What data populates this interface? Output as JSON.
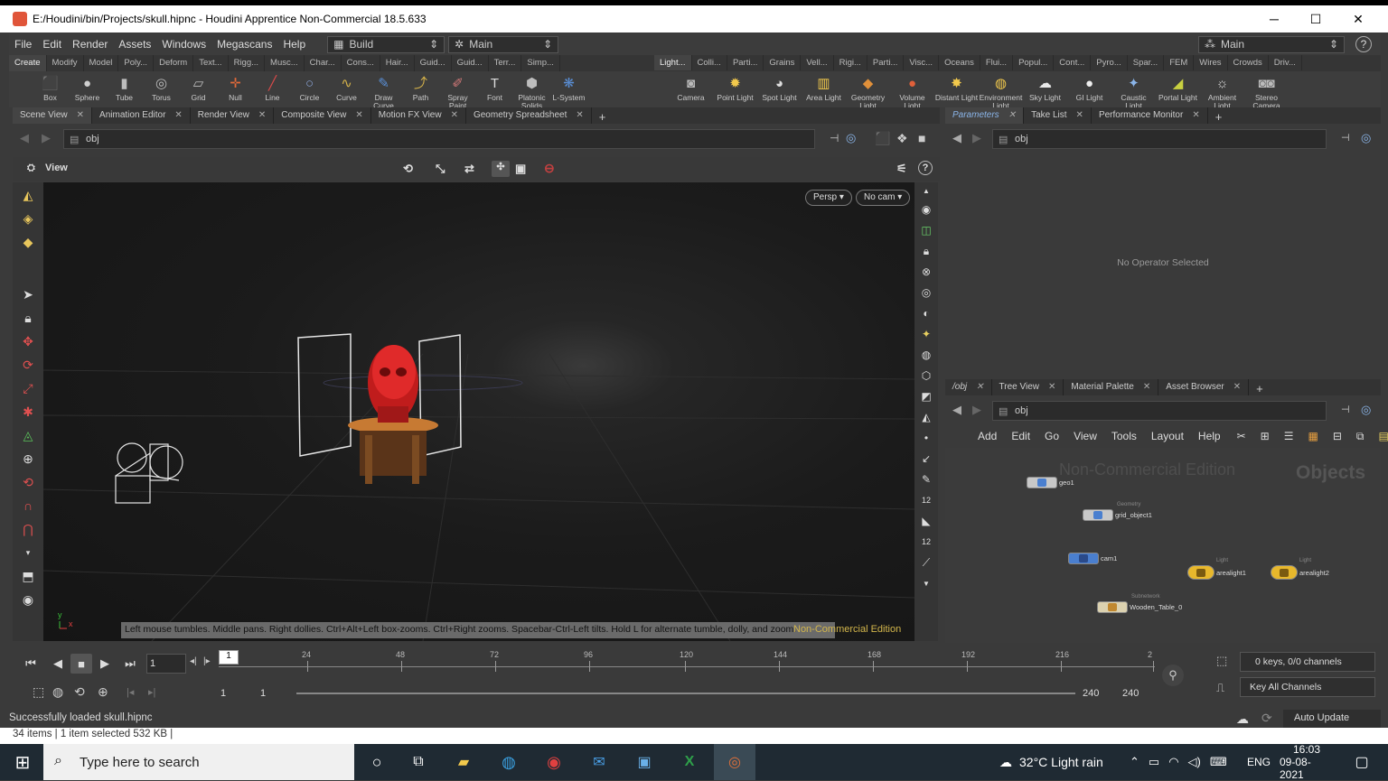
{
  "window": {
    "title": "E:/Houdini/bin/Projects/skull.hipnc - Houdini Apprentice Non-Commercial 18.5.633",
    "minimize": "─",
    "maximize": "☐",
    "close": "✕"
  },
  "menu": {
    "items": [
      "File",
      "Edit",
      "Render",
      "Assets",
      "Windows",
      "Megascans",
      "Help"
    ],
    "desktop": "Build",
    "desktop_right": "Main",
    "view_main": "Main"
  },
  "shelf_tabs_left": [
    "Create",
    "Modify",
    "Model",
    "Poly...",
    "Deform",
    "Text...",
    "Rigg...",
    "Musc...",
    "Char...",
    "Cons...",
    "Hair...",
    "Guid...",
    "Guid...",
    "Terr...",
    "Simp..."
  ],
  "shelf_tabs_right": [
    "Light...",
    "Colli...",
    "Parti...",
    "Grains",
    "Vell...",
    "Rigi...",
    "Parti...",
    "Visc...",
    "Oceans",
    "Flui...",
    "Popul...",
    "Cont...",
    "Pyro...",
    "Spar...",
    "FEM",
    "Wires",
    "Crowds",
    "Driv..."
  ],
  "tools_left": [
    {
      "label": "Box",
      "icon": "⬛",
      "color": "#bdbdbd"
    },
    {
      "label": "Sphere",
      "icon": "●",
      "color": "#cfcfcf"
    },
    {
      "label": "Tube",
      "icon": "▮",
      "color": "#bdbdbd"
    },
    {
      "label": "Torus",
      "icon": "◎",
      "color": "#bdbdbd"
    },
    {
      "label": "Grid",
      "icon": "▱",
      "color": "#bdbdbd"
    },
    {
      "label": "Null",
      "icon": "✛",
      "color": "#e26a3a"
    },
    {
      "label": "Line",
      "icon": "╱",
      "color": "#d94a4a"
    },
    {
      "label": "Circle",
      "icon": "○",
      "color": "#8aa3d6"
    },
    {
      "label": "Curve",
      "icon": "∿",
      "color": "#d6b34a"
    },
    {
      "label": "Draw Curve",
      "icon": "✎",
      "color": "#5a8fd6"
    },
    {
      "label": "Path",
      "icon": "⤴",
      "color": "#d6b34a"
    },
    {
      "label": "Spray Paint",
      "icon": "✐",
      "color": "#d67a7a"
    },
    {
      "label": "Font",
      "icon": "T",
      "color": "#dddddd"
    },
    {
      "label": "Platonic Solids",
      "icon": "⬢",
      "color": "#bdbdbd"
    },
    {
      "label": "L-System",
      "icon": "❋",
      "color": "#5a8fd6"
    }
  ],
  "tools_right": [
    {
      "label": "Camera",
      "icon": "◙",
      "color": "#bbbbbb"
    },
    {
      "label": "Point Light",
      "icon": "✹",
      "color": "#f2c94c"
    },
    {
      "label": "Spot Light",
      "icon": "◕",
      "color": "#dddddd"
    },
    {
      "label": "Area Light",
      "icon": "▥",
      "color": "#f2c94c"
    },
    {
      "label": "Geometry Light",
      "icon": "◆",
      "color": "#e0903a"
    },
    {
      "label": "Volume Light",
      "icon": "●",
      "color": "#e0603a"
    },
    {
      "label": "Distant Light",
      "icon": "✸",
      "color": "#f2c94c"
    },
    {
      "label": "Environment Light",
      "icon": "◍",
      "color": "#f2c94c"
    },
    {
      "label": "Sky Light",
      "icon": "☁",
      "color": "#e8e8e8"
    },
    {
      "label": "GI Light",
      "icon": "●",
      "color": "#eeeeee"
    },
    {
      "label": "Caustic Light",
      "icon": "✦",
      "color": "#8ab4e8"
    },
    {
      "label": "Portal Light",
      "icon": "◢",
      "color": "#c8d040"
    },
    {
      "label": "Ambient Light",
      "icon": "☼",
      "color": "#dddddd"
    },
    {
      "label": "Stereo Camera",
      "icon": "◙◙",
      "color": "#bbbbbb"
    }
  ],
  "pane_tabs_left": [
    "Scene View",
    "Animation Editor",
    "Render View",
    "Composite View",
    "Motion FX View",
    "Geometry Spreadsheet"
  ],
  "pane_tabs_params": [
    "Parameters",
    "Take List",
    "Performance Monitor"
  ],
  "pane_tabs_net": [
    "/obj",
    "Tree View",
    "Material Palette",
    "Asset Browser"
  ],
  "path_left": "obj",
  "path_params": "obj",
  "path_net": "obj",
  "viewer": {
    "title": "View",
    "persp": "Persp ▾",
    "cam": "No cam ▾",
    "hint": "Left mouse tumbles. Middle pans. Right dollies. Ctrl+Alt+Left box-zooms. Ctrl+Right zooms. Spacebar-Ctrl-Left tilts. Hold L for alternate tumble, dolly, and zoom.",
    "watermark": "Non-Commercial Edition"
  },
  "params": {
    "empty": "No Operator Selected"
  },
  "net": {
    "menu": [
      "Add",
      "Edit",
      "Go",
      "View",
      "Tools",
      "Layout",
      "Help"
    ],
    "watermark": "Non-Commercial Edition",
    "context": "Objects",
    "nodes": [
      {
        "name": "geo1",
        "type": ""
      },
      {
        "name": "grid_object1",
        "type": "Geometry"
      },
      {
        "name": "cam1",
        "type": ""
      },
      {
        "name": "arealight1",
        "type": "Light"
      },
      {
        "name": "arealight2",
        "type": "Light"
      },
      {
        "name": "Wooden_Table_0",
        "type": "Subnetwork"
      }
    ]
  },
  "timeline": {
    "frame": "1",
    "ticks": [
      "24",
      "48",
      "72",
      "96",
      "120",
      "144",
      "168",
      "192",
      "216",
      "2"
    ],
    "cur_marker": "1",
    "start": "1",
    "start2": "1",
    "end": "240",
    "end2": "240",
    "keys": "0 keys, 0/0 channels",
    "keyall": "Key All Channels",
    "auto": "Auto Update"
  },
  "status": "Successfully loaded skull.hipnc",
  "explorer": "34 items   |   1 item selected  532 KB   |",
  "taskbar": {
    "search": "Type here to search",
    "weather": "32°C  Light rain",
    "lang": "ENG",
    "time": "16:03",
    "date": "09-08-2021"
  }
}
